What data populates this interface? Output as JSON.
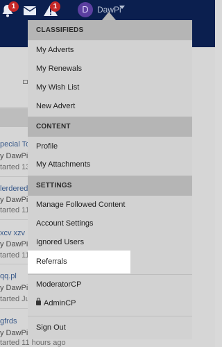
{
  "topbar": {
    "alerts_badge": "1",
    "messages_badge": "1",
    "avatar_letter": "D",
    "username": "DawPi"
  },
  "background_threads": [
    {
      "title": "pecial To",
      "by": "y DawPi",
      "meta": "tarted 13"
    },
    {
      "title": "lerderede",
      "by": "y DawPi",
      "meta": "tarted 11"
    },
    {
      "title": "xcv xzv",
      "by": "y DawPi",
      "meta": "tarted 11"
    },
    {
      "title": "qq.pl",
      "by": "y DawPi",
      "meta": "tarted Ju"
    },
    {
      "title": "gfrds",
      "by": "y DawPi",
      "meta": "tarted 11 hours ago"
    }
  ],
  "menu": {
    "classifieds_header": "CLASSIFIEDS",
    "my_adverts": "My Adverts",
    "my_renewals": "My Renewals",
    "my_wish_list": "My Wish List",
    "new_advert": "New Advert",
    "content_header": "CONTENT",
    "profile": "Profile",
    "my_attachments": "My Attachments",
    "settings_header": "SETTINGS",
    "manage_followed": "Manage Followed Content",
    "account_settings": "Account Settings",
    "ignored_users": "Ignored Users",
    "referrals": "Referrals",
    "moderator_cp": "ModeratorCP",
    "admin_cp": "AdminCP",
    "sign_out": "Sign Out"
  },
  "colors": {
    "nav_bg": "#0b1f4f",
    "badge": "#c62828",
    "avatar": "#5b3fa0",
    "highlight": "#ffffff"
  }
}
